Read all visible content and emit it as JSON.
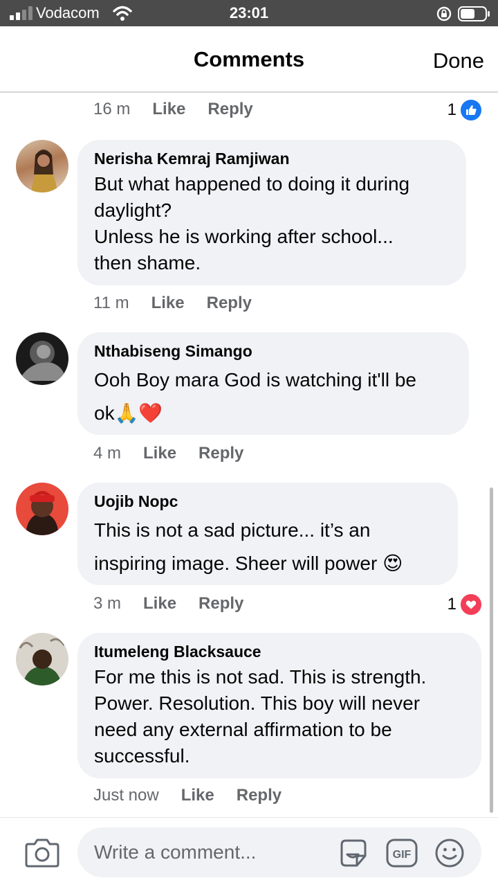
{
  "status_bar": {
    "carrier": "Vodacom",
    "time": "23:01"
  },
  "header": {
    "title": "Comments",
    "done_label": "Done"
  },
  "actions": {
    "like": "Like",
    "reply": "Reply"
  },
  "top_meta": {
    "time": "16 m",
    "reaction_count": "1",
    "reaction_icon": "like-icon"
  },
  "comments": [
    {
      "author": "Nerisha Kemraj Ramjiwan",
      "lines": [
        "But what happened to doing it during",
        "daylight?",
        "Unless he is working after school...",
        "then shame."
      ],
      "time": "11 m"
    },
    {
      "author": "Nthabiseng Simango",
      "lines": [
        "Ooh Boy mara God is watching it'll be",
        "ok🙏❤️"
      ],
      "time": "4 m"
    },
    {
      "author": "Uojib Nopc",
      "lines": [
        "This is not a sad picture... it’s an",
        "inspiring image. Sheer will power 😍"
      ],
      "time": "3 m",
      "reaction_count": "1",
      "reaction_icon": "love-icon"
    },
    {
      "author": "Itumeleng Blacksauce",
      "lines": [
        "For me this is not sad. This is strength.",
        "Power. Resolution. This boy will never",
        "need any external affirmation to be",
        "successful."
      ],
      "time": "Just now"
    }
  ],
  "composer": {
    "placeholder": "Write a comment..."
  },
  "colors": {
    "like_blue": "#1877f2",
    "love_red": "#f33e58",
    "bubble": "#f0f2f5",
    "meta_gray": "#65676b"
  }
}
